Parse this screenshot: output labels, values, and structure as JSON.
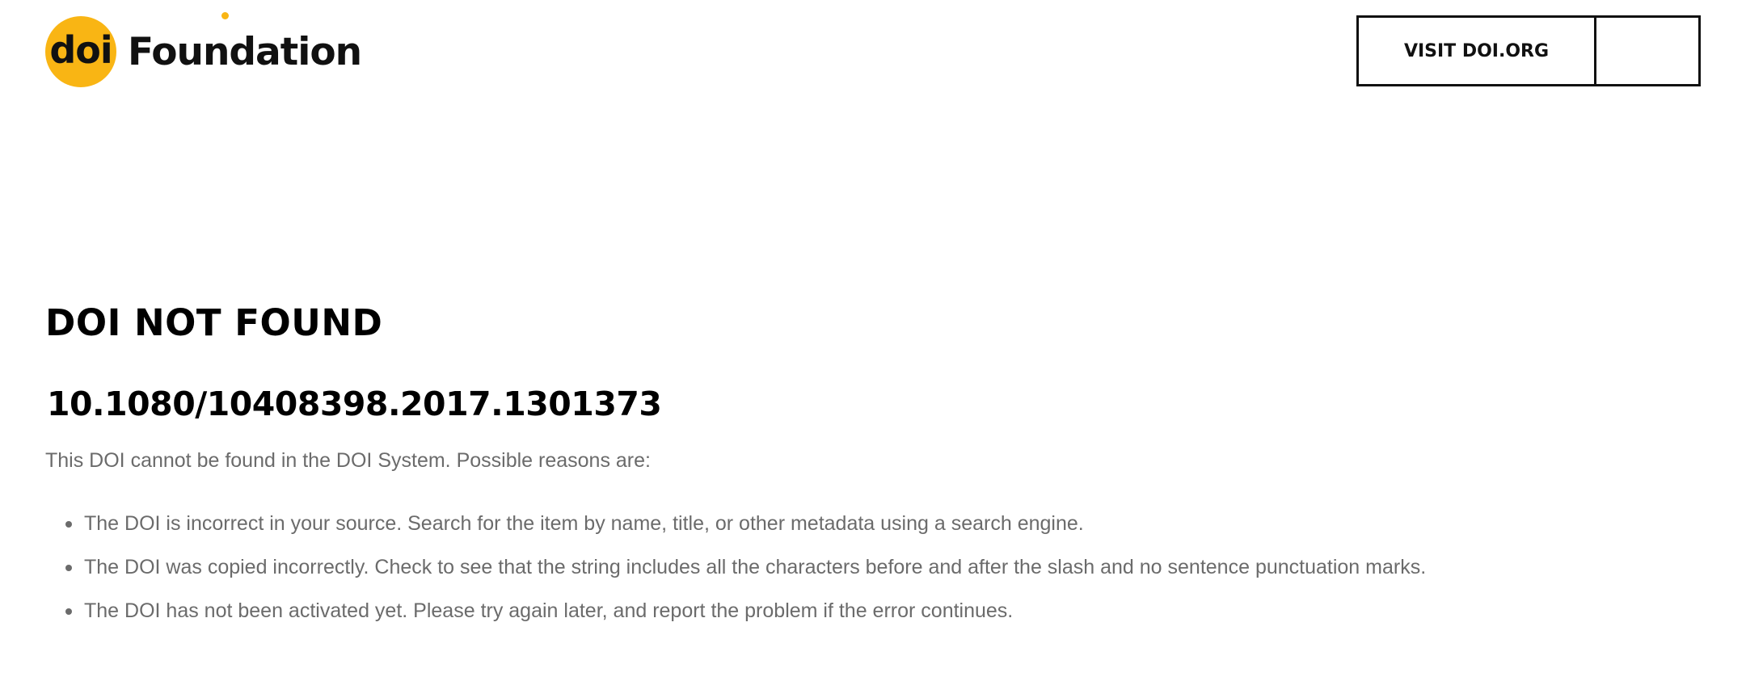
{
  "header": {
    "logo_mark": "doi",
    "logo_word": "Foundation",
    "visit_label": "VISIT DOI.ORG"
  },
  "main": {
    "title": "DOI NOT FOUND",
    "doi": "10.1080/10408398.2017.1301373",
    "intro": "This DOI cannot be found in the DOI System. Possible reasons are:",
    "reasons": [
      "The DOI is incorrect in your source. Search for the item by name, title, or other metadata using a search engine.",
      "The DOI was copied incorrectly. Check to see that the string includes all the characters before and after the slash and no sentence punctuation marks.",
      "The DOI has not been activated yet. Please try again later, and report the problem if the error continues."
    ]
  },
  "colors": {
    "brand_yellow": "#f9b514",
    "text_dark": "#000000",
    "text_muted": "#6b6b6b"
  }
}
